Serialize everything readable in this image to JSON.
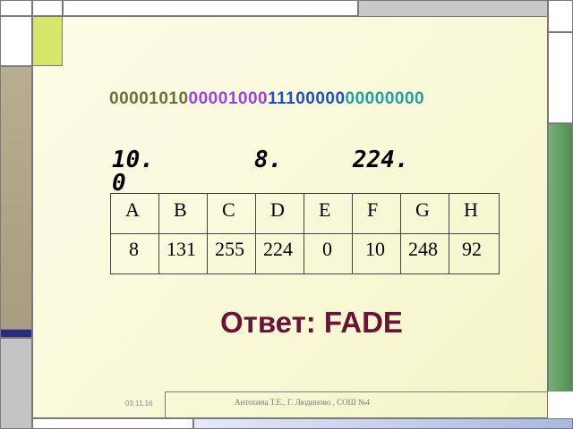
{
  "bits": [
    {
      "text": "00001010",
      "color": "#6e6e3a"
    },
    {
      "text": "00001000",
      "color": "#a040e0"
    },
    {
      "text": "11100000",
      "color": "#2050c0"
    },
    {
      "text": "00000000",
      "color": "#20a0a0"
    }
  ],
  "octets": [
    "10.0",
    "8.",
    "224."
  ],
  "table": {
    "letters": [
      "A",
      "B",
      "C",
      "D",
      "E",
      "F",
      "G",
      "H"
    ],
    "numbers": [
      "8",
      "131",
      "255",
      "224",
      "0",
      "10",
      "248",
      "92"
    ]
  },
  "answer": "Ответ: FADE",
  "footer": {
    "date": "03.11.16",
    "author": "Антохина Т.Е., Г. Людиново , СОШ №4"
  },
  "colors": {
    "answer": "#6b1237",
    "frame_green": "#d6e66a",
    "frame_tan": "#b0a58a",
    "frame_navy": "#2a2a80",
    "frame_green_dark": "#5e9e5e",
    "frame_gray": "#bdbdbd"
  }
}
